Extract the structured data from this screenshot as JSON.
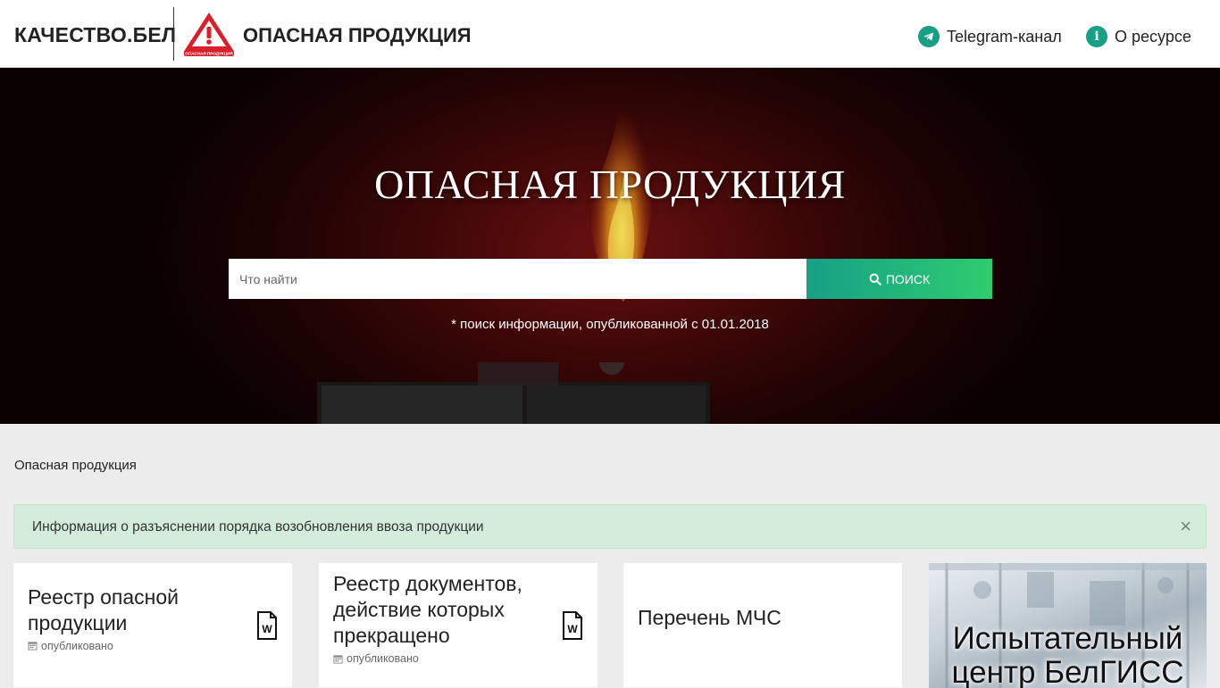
{
  "header": {
    "brand": "КАЧЕСТВО.БЕЛ",
    "logo_caption": "ОПАСНАЯ ПРОДУКЦИЯ",
    "site_title": "ОПАСНАЯ ПРОДУКЦИЯ",
    "nav": {
      "telegram": "Telegram-канал",
      "about": "О ресурсе"
    }
  },
  "hero": {
    "title": "ОПАСНАЯ ПРОДУКЦИЯ",
    "search": {
      "placeholder": "Что найти",
      "button": "ПОИСК"
    },
    "note": "* поиск информации, опубликованной с 01.01.2018"
  },
  "breadcrumb": "Опасная продукция",
  "alert": {
    "text": "Информация о разъяснении порядка возобновления ввоза продукции",
    "close": "×"
  },
  "cards": [
    {
      "title": "Реестр опасной продукции",
      "meta": "опубликовано",
      "icon": "word-file-icon"
    },
    {
      "title": "Реестр документов, действие которых прекращено",
      "meta": "опубликовано",
      "icon": "word-file-icon"
    },
    {
      "title": "Перечень МЧС"
    }
  ],
  "banner": {
    "text": "Испытательный центр БелГИСС"
  },
  "colors": {
    "accent": "#16a085",
    "accent_end": "#2ecc71",
    "alert_bg": "#d4edda",
    "logo_red": "#d9202a"
  }
}
